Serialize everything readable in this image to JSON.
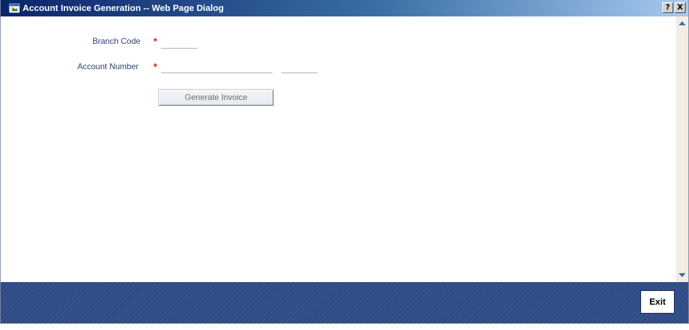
{
  "window": {
    "title": "Account Invoice Generation -- Web Page Dialog",
    "help_label": "?",
    "close_label": "X"
  },
  "form": {
    "branch_code": {
      "label": "Branch Code",
      "required_mark": "*",
      "value": ""
    },
    "account_number": {
      "label": "Account Number",
      "required_mark": "*",
      "value": "",
      "secondary_value": ""
    },
    "generate_button_label": "Generate Invoice"
  },
  "footer": {
    "exit_label": "Exit"
  },
  "colors": {
    "footer_bg": "#2d4a86",
    "label_text": "#2e3f6f",
    "required_mark": "#e21c1c"
  },
  "icons": [
    "window-app-icon",
    "scroll-up-arrow-icon",
    "scroll-down-arrow-icon"
  ]
}
